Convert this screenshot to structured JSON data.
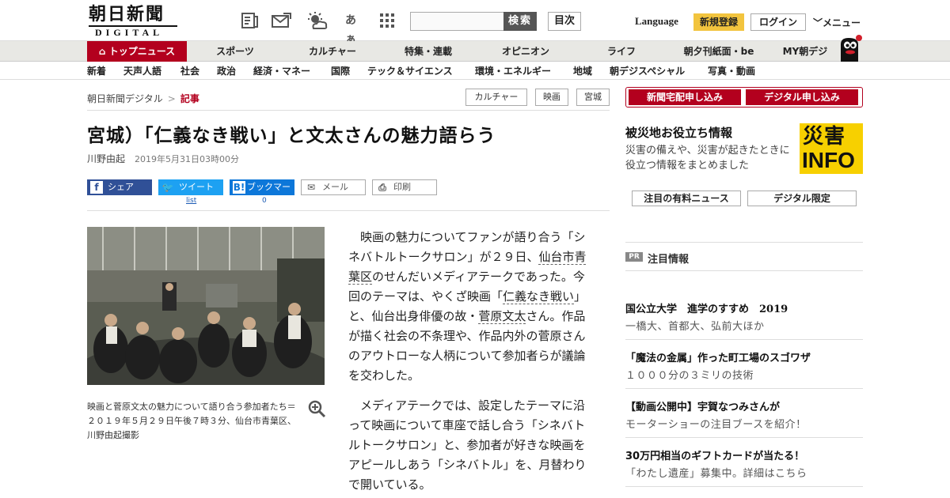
{
  "header": {
    "logo_main": "朝日新聞",
    "logo_sub": "DIGITAL",
    "icons": [
      "paper-icon",
      "mail-icon",
      "weather-icon",
      "font-size-icon",
      "grid-icon"
    ],
    "font_size_glyph": "あぁ",
    "search_button": "検索",
    "toc_button": "目次",
    "language": "Language",
    "register": "新規登録",
    "login": "ログイン",
    "menu": "メニュー"
  },
  "nav_primary": [
    "トップニュース",
    "スポーツ",
    "カルチャー",
    "特集・連載",
    "オピニオン",
    "ライフ",
    "朝夕刊紙面・be",
    "MY朝デジ"
  ],
  "nav_secondary": [
    "新着",
    "天声人語",
    "社会",
    "政治",
    "経済・マネー",
    "国際",
    "テック＆サイエンス",
    "環境・エネルギー",
    "地域",
    "朝デジスペシャル",
    "写真・動画"
  ],
  "breadcrumb": {
    "home": "朝日新聞デジタル",
    "separator": ">",
    "current": "記事"
  },
  "tags": [
    "カルチャー",
    "映画",
    "宮城"
  ],
  "article": {
    "title": "宮城）「仁義なき戦い」と文太さんの魅力語らう",
    "author": "川野由起",
    "date": "2019年5月31日03時00分",
    "caption": "映画と菅原文太の魅力について語り合う参加者たち＝２０１９年５月２９日午後７時３分、仙台市青葉区、川野由起撮影",
    "p1_a": "映画の魅力についてファンが語り合う「シネバトルトークサロン」が２９日、",
    "p1_kw1": "仙台市青葉区",
    "p1_b": "のせんだいメディアテークであった。今回のテーマは、やくざ映画「",
    "p1_kw2": "仁義なき戦い",
    "p1_c": "」と、仙台出身俳優の故・",
    "p1_kw3": "菅原文太",
    "p1_d": "さん。作品が描く社会の不条理や、作品内外の菅原さんのアウトローな人柄について参加者らが議論を交わした。",
    "p2": "メディアテークでは、設定したテーマに沿って映画について車座で話し合う「シネバトルトークサロン」と、参加者が好きな映画をアピールしあう「シネバトル」を、月替わりで開いている。"
  },
  "share": {
    "facebook": "シェア",
    "twitter": "ツイート",
    "hatena": "ブックマーク",
    "mail": "メール",
    "print": "印刷",
    "twitter_sub": "list",
    "hatena_sub": "0"
  },
  "sidebar": {
    "subscribe_paper": "新聞宅配申し込み",
    "subscribe_digital": "デジタル申し込み",
    "disaster_title": "被災地お役立ち情報",
    "disaster_desc": "災害の備えや、災害が起きたときに役立つ情報をまとめました",
    "disaster_logo_1": "災害",
    "disaster_logo_2": "INFO",
    "featured_paid": "注目の有料ニュース",
    "featured_digital": "デジタル限定",
    "pr_badge": "PR",
    "pr_label": "注目情報",
    "ads": [
      {
        "title": "国公立大学　進学のすすめ　2019",
        "sub": "一橋大、首都大、弘前大ほか"
      },
      {
        "title": "「魔法の金属」作った町工場のスゴワザ",
        "sub": "１０００分の３ミリの技術"
      },
      {
        "title": "【動画公開中】宇賀なつみさんが",
        "sub": "モーターショーの注目ブースを紹介！"
      },
      {
        "title": "30万円相当のギフトカードが当たる！",
        "sub": "「わたし遺産」募集中。詳細はこちら"
      }
    ]
  },
  "colors": {
    "brand_red": "#b3001e",
    "register_yellow": "#f2c43e",
    "facebook": "#305097",
    "twitter": "#1da1f2",
    "hatena": "#0d77d9",
    "disaster_yellow": "#f7d000"
  }
}
